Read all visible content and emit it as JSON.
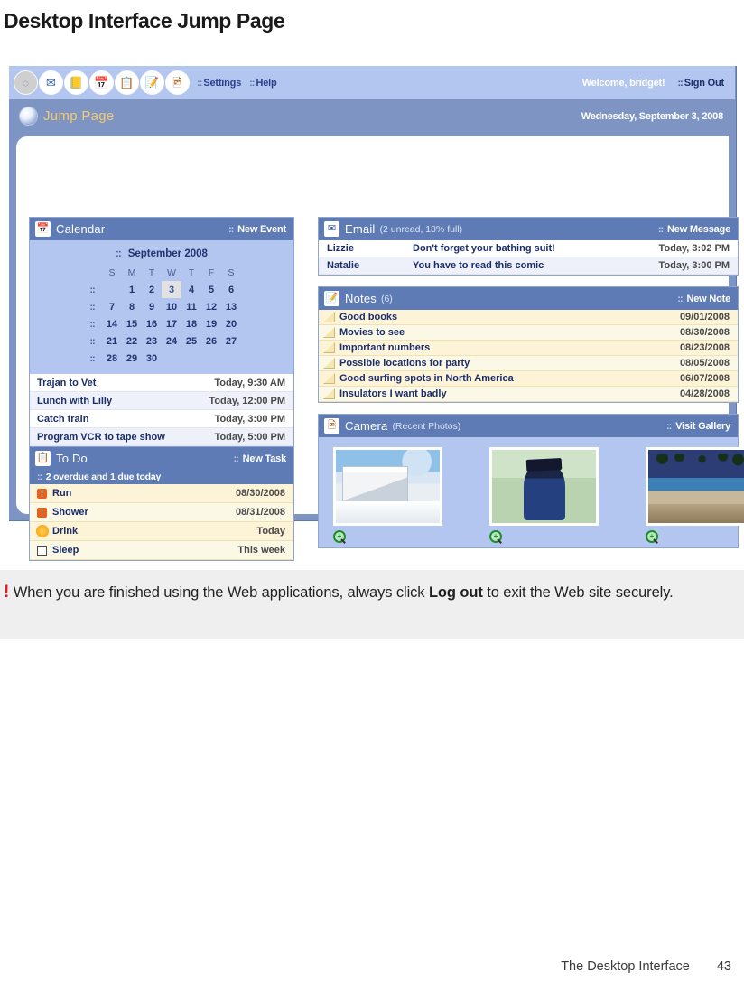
{
  "page": {
    "title": "Desktop Interface Jump Page",
    "footer_label": "The Desktop Interface",
    "footer_page": "43"
  },
  "toolbar": {
    "icons": [
      {
        "name": "jump-page-orb-icon",
        "glyph": "◌"
      },
      {
        "name": "email-icon",
        "glyph": "✉"
      },
      {
        "name": "address-book-icon",
        "glyph": "📒"
      },
      {
        "name": "calendar-icon",
        "glyph": "📅"
      },
      {
        "name": "todo-list-icon",
        "glyph": "📋"
      },
      {
        "name": "notes-icon",
        "glyph": "📝"
      },
      {
        "name": "camera-photos-icon",
        "glyph": "🖼"
      }
    ],
    "settings_label": "Settings",
    "help_label": "Help",
    "welcome": "Welcome, bridget!",
    "sign_out_label": "Sign Out",
    "dots": "::"
  },
  "jumpbar": {
    "title": "Jump Page",
    "date": "Wednesday, September 3, 2008"
  },
  "calendar": {
    "header_title": "Calendar",
    "new_event_label": "New Event",
    "month_label": "September 2008",
    "weekdays": [
      "S",
      "M",
      "T",
      "W",
      "T",
      "F",
      "S"
    ],
    "weeks": [
      [
        "",
        "1",
        "2",
        "3",
        "4",
        "5",
        "6"
      ],
      [
        "7",
        "8",
        "9",
        "10",
        "11",
        "12",
        "13"
      ],
      [
        "14",
        "15",
        "16",
        "17",
        "18",
        "19",
        "20"
      ],
      [
        "21",
        "22",
        "23",
        "24",
        "25",
        "26",
        "27"
      ],
      [
        "28",
        "29",
        "30",
        "",
        "",
        "",
        ""
      ]
    ],
    "today": "3",
    "appointments": [
      {
        "name": "Trajan to Vet",
        "time": "Today, 9:30 AM"
      },
      {
        "name": "Lunch with Lilly",
        "time": "Today, 12:00 PM"
      },
      {
        "name": "Catch train",
        "time": "Today, 3:00 PM"
      },
      {
        "name": "Program VCR to tape show",
        "time": "Today, 5:00 PM"
      }
    ]
  },
  "todo": {
    "header_title": "To Do",
    "new_task_label": "New Task",
    "summary": "2 overdue and 1 due today",
    "items": [
      {
        "icon": "alert",
        "name": "Run",
        "date": "08/30/2008"
      },
      {
        "icon": "alert",
        "name": "Shower",
        "date": "08/31/2008"
      },
      {
        "icon": "sun",
        "name": "Drink",
        "date": "Today"
      },
      {
        "icon": "box",
        "name": "Sleep",
        "date": "This week"
      }
    ]
  },
  "email": {
    "header_title": "Email",
    "header_sub": "(2 unread, 18% full)",
    "new_message_label": "New Message",
    "messages": [
      {
        "from": "Lizzie",
        "subject": "Don't forget your bathing suit!",
        "time": "Today, 3:02 PM"
      },
      {
        "from": "Natalie",
        "subject": "You have to read this comic",
        "time": "Today, 3:00 PM"
      }
    ]
  },
  "notes": {
    "header_title": "Notes",
    "header_sub": "(6)",
    "new_note_label": "New Note",
    "items": [
      {
        "name": "Good books",
        "date": "09/01/2008"
      },
      {
        "name": "Movies to see",
        "date": "08/30/2008"
      },
      {
        "name": "Important numbers",
        "date": "08/23/2008"
      },
      {
        "name": "Possible locations for party",
        "date": "08/05/2008"
      },
      {
        "name": "Good surfing spots in North America",
        "date": "06/07/2008"
      },
      {
        "name": "Insulators I want badly",
        "date": "04/28/2008"
      }
    ]
  },
  "camera": {
    "header_title": "Camera",
    "header_sub": "(Recent Photos)",
    "visit_gallery_label": "Visit Gallery",
    "photos": [
      {
        "name": "photo-snowy-house",
        "art": "ph-snow"
      },
      {
        "name": "photo-graduation",
        "art": "ph-grad"
      },
      {
        "name": "photo-palm-harbor",
        "art": "ph-beach"
      }
    ]
  },
  "callout": {
    "bang": "!",
    "text_before": "When you are finished using the Web applications, always click ",
    "bold": "Log out",
    "text_after": " to exit the Web site securely."
  },
  "colors": {
    "toolbar_bg": "#b3c6f0",
    "header_blue": "#5e7bb5",
    "frame_blue": "#7e95c4",
    "accent_gold": "#f5c96a",
    "note_yellow": "#fdf3d7",
    "alert_orange": "#e8601c",
    "callout_red": "#e01b22"
  }
}
